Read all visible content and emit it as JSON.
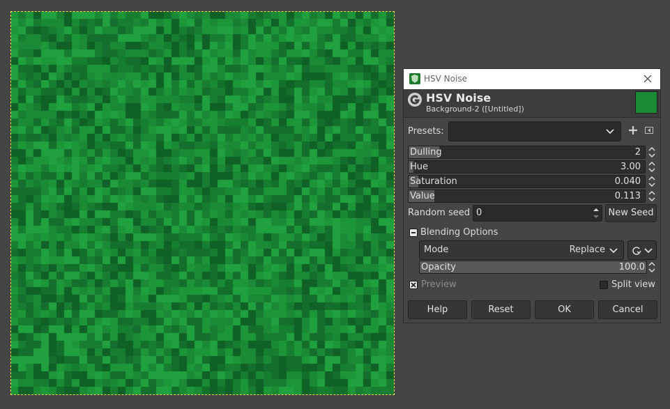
{
  "canvas": {
    "base_color": "#1a8a36",
    "palette": [
      "#136f2b",
      "#177e31",
      "#1a8a36",
      "#1d9639",
      "#21a03f",
      "#0f6126"
    ]
  },
  "dialog": {
    "window_title": "HSV Noise",
    "header_title": "HSV Noise",
    "header_subtitle": "Background-2 ([Untitled])",
    "swatch_color": "#1a8a36",
    "presets": {
      "label": "Presets:",
      "value": ""
    },
    "sliders": [
      {
        "label": "Dulling",
        "value": "2",
        "fraction": 0.13
      },
      {
        "label": "Hue",
        "value": "3.00",
        "fraction": 0.02
      },
      {
        "label": "Saturation",
        "value": "0.040",
        "fraction": 0.04
      },
      {
        "label": "Value",
        "value": "0.113",
        "fraction": 0.11
      }
    ],
    "random_seed": {
      "label": "Random seed",
      "value": "0",
      "new_seed": "New Seed"
    },
    "blending": {
      "label": "Blending Options",
      "mode_label": "Mode",
      "mode_value": "Replace",
      "opacity_label": "Opacity",
      "opacity_value": "100.0",
      "opacity_fraction": 1.0
    },
    "preview": {
      "label": "Preview",
      "checked": true
    },
    "split_view": {
      "label": "Split view",
      "checked": false
    },
    "buttons": {
      "help": "Help",
      "reset": "Reset",
      "ok": "OK",
      "cancel": "Cancel"
    }
  }
}
